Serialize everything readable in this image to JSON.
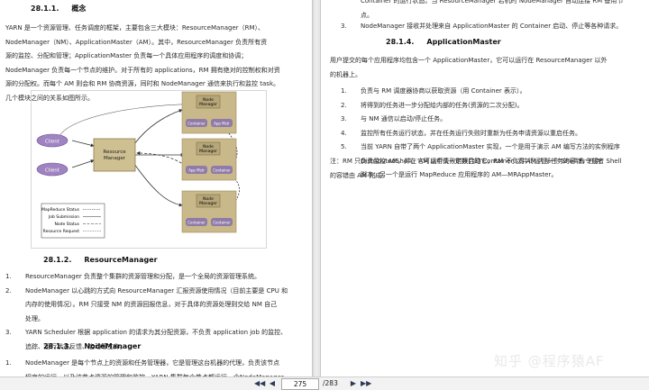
{
  "left_page": {
    "sec_concept": {
      "num": "28.1.1.",
      "title": "概念"
    },
    "concept_lines": [
      "YARN 是一个资源管理、任务调度的框架，主要包含三大模块：ResourceManager（RM）、",
      "NodeManager（NM）、ApplicationMaster（AM）。其中，ResourceManager 负责所有资",
      "源的监控、分配和管理；ApplicationMaster 负责每一个具体应用程序的调度和协调；",
      "NodeManager 负责每一个节点的维护。对于所有的 applications，RM 拥有绝对的控制权和对资",
      "源的分配权。而每个 AM 则会和 RM 协商资源，同时和 NodeManager 通信来执行和监控 task。",
      "几个模块之间的关系如图所示。"
    ],
    "diagram": {
      "client1": "Client",
      "client2": "Client",
      "resource_manager": [
        "Resource",
        "Manager"
      ],
      "node_manager": [
        "Node",
        "Manager"
      ],
      "container": "Container",
      "app_mstr": "App Mstr",
      "legend": [
        "MapReduce Status",
        "Job Submission",
        "Node Status",
        "Resource Request"
      ]
    },
    "sec_rm": {
      "num": "28.1.2.",
      "title": "ResourceManager"
    },
    "rm_items": [
      {
        "marker": "1.",
        "lines": [
          "ResourceManager 负责整个集群的资源管理和分配，是一个全局的资源管理系统。"
        ]
      },
      {
        "marker": "2.",
        "lines": [
          "NodeManager 以心跳的方式向 ResourceManager 汇报资源使用情况（目前主要是 CPU 和",
          "内存的使用情况）。RM 只接受 NM 的资源回报信息，对于具体的资源处理则交给 NM 自己",
          "处理。"
        ]
      },
      {
        "marker": "3.",
        "lines": [
          "YARN Scheduler 根据 application 的请求为其分配资源，不负责 application job 的监控、",
          "追踪、运行状态反馈、启动等工作。"
        ]
      }
    ],
    "sec_nm": {
      "num": "28.1.3.",
      "title": "NodeManager"
    },
    "nm_items": [
      {
        "marker": "1.",
        "lines": [
          "NodeManager 是每个节点上的资源和任务管理器，它是管理这台机器的代理，负责该节点",
          "程序的运行，以及该节点资源的管理和监控。YARN 集群每个节点都运行一个NodeManager。"
        ]
      }
    ]
  },
  "right_page": {
    "top_cont_lines": [
      "Container 的运行状态。当 ResourceManager 宕机时 NodeManager 自动连接 RM 备用节",
      "点。"
    ],
    "top_items": [
      {
        "marker": "3.",
        "lines": [
          "NodeManager 接收并处理来自 ApplicationMaster 的 Container 启动、停止等各种请求。"
        ]
      }
    ],
    "sec_am": {
      "num": "28.1.4.",
      "title": "ApplicationMaster"
    },
    "am_intro_lines": [
      "用户提交的每个应用程序均包含一个 ApplicationMaster，它可以运行在 ResourceManager 以外",
      "的机器上。"
    ],
    "am_items": [
      {
        "marker": "1.",
        "lines": [
          "负责与 RM 调度器协商以获取资源（用 Container 表示）。"
        ]
      },
      {
        "marker": "2.",
        "lines": [
          "将得到的任务进一步分配给内部的任务(资源的二次分配)。"
        ]
      },
      {
        "marker": "3.",
        "lines": [
          "与 NM 通信以启动/停止任务。"
        ]
      },
      {
        "marker": "4.",
        "lines": [
          "监控所有任务运行状态，并在任务运行失败时重新为任务申请资源以重启任务。"
        ]
      },
      {
        "marker": "5.",
        "lines": [
          "当前 YARN 自带了两个 ApplicationMaster 实现，一个是用于演示 AM 编写方法的实例程序",
          "DistributedShell，它可以申请一定数目的 Container 以并行运行一个 Shell 命令或者 Shell",
          "脚本；另一个是运行 MapReduce 应用程序的 AM—MRAppMaster。"
        ]
      }
    ],
    "note_lines": [
      "注：RM 只负责监控 AM，并在 AM 运行失败时候启动它。RM 不负责 AM 内部任务的容错，任务",
      "的容错由 AM 完成。"
    ]
  },
  "toolbar": {
    "current_page": "275",
    "total": "/283",
    "first_icon": "first-page-icon",
    "prev_icon": "prev-page-icon",
    "next_icon": "next-page-icon",
    "last_icon": "last-page-icon"
  },
  "watermark": "知乎 @程序猿AF",
  "colors": {
    "node_box": "#c9b889",
    "node_box_dark": "#9b8a5e",
    "rm_box": "#cfc092",
    "client": "#a084c2",
    "container": "#8f7aa8",
    "accent_blue": "#2f55c8"
  }
}
